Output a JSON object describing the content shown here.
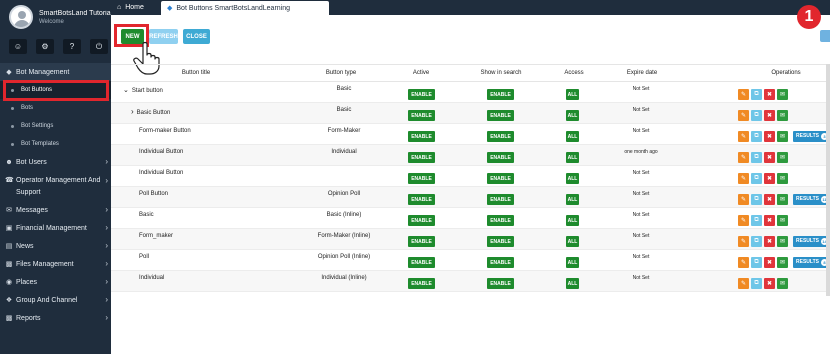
{
  "sidebar": {
    "profile_name": "SmartBotsLand Tutorial",
    "profile_welcome": "Welcome",
    "quick_icons": [
      "user-icon",
      "settings-icon",
      "help-icon",
      "power-icon"
    ],
    "menu": [
      {
        "label": "Bot Management",
        "icon": "diamond-icon",
        "open": true
      },
      {
        "label": "Bot Users",
        "icon": "users-icon"
      },
      {
        "label": "Operator Management And Support",
        "icon": "headset-icon"
      },
      {
        "label": "Messages",
        "icon": "envelope-icon"
      },
      {
        "label": "Financial Management",
        "icon": "money-icon"
      },
      {
        "label": "News",
        "icon": "newspaper-icon"
      },
      {
        "label": "Files Management",
        "icon": "folder-icon"
      },
      {
        "label": "Places",
        "icon": "pin-icon"
      },
      {
        "label": "Group And Channel",
        "icon": "group-icon"
      },
      {
        "label": "Reports",
        "icon": "chart-icon"
      }
    ],
    "submenu": [
      "Bot Buttons",
      "Bots",
      "Bot Settings",
      "Bot Templates"
    ],
    "active_submenu": "Bot Buttons"
  },
  "topbar": {
    "home_tab": "Home",
    "current_tab": "Bot Buttons SmartBotsLandLearning"
  },
  "toolbar": {
    "new_label": "NEW",
    "refresh_label": "REFRESH",
    "close_label": "CLOSE"
  },
  "step_badge": "1",
  "table": {
    "headers": {
      "title": "Button title",
      "type": "Button type",
      "active": "Active",
      "search": "Show in search",
      "access": "Access",
      "expire": "Expire date",
      "operations": "Operations"
    },
    "rows": [
      {
        "title": "Start button",
        "type": "Basic",
        "active": "ENABLE",
        "search": "ENABLE",
        "access": "ALL",
        "expire": "Not Set",
        "expander": "down"
      },
      {
        "title": "Basic Button",
        "type": "Basic",
        "active": "ENABLE",
        "search": "ENABLE",
        "access": "ALL",
        "expire": "Not Set",
        "expander": "right"
      },
      {
        "title": "Form-maker Button",
        "type": "Form-Maker",
        "active": "ENABLE",
        "search": "ENABLE",
        "access": "ALL",
        "expire": "Not Set",
        "results": "RESULTS",
        "results_count": "3"
      },
      {
        "title": "Individual Button",
        "type": "Individual",
        "active": "ENABLE",
        "search": "ENABLE",
        "access": "ALL",
        "expire": "one month ago"
      },
      {
        "title": "Individual Button",
        "type": "",
        "active": "ENABLE",
        "search": "ENABLE",
        "access": "ALL",
        "expire": "Not Set"
      },
      {
        "title": "Poll Button",
        "type": "Opinion Poll",
        "active": "ENABLE",
        "search": "ENABLE",
        "access": "ALL",
        "expire": "Not Set",
        "results": "RESULTS",
        "results_count": "11"
      },
      {
        "title": "Basic",
        "type": "Basic (Inline)",
        "active": "ENABLE",
        "search": "ENABLE",
        "access": "ALL",
        "expire": "Not Set"
      },
      {
        "title": "Form_maker",
        "type": "Form-Maker (Inline)",
        "active": "ENABLE",
        "search": "ENABLE",
        "access": "ALL",
        "expire": "Not Set",
        "results": "RESULTS",
        "results_count": "14"
      },
      {
        "title": "Poll",
        "type": "Opinion Poll (Inline)",
        "active": "ENABLE",
        "search": "ENABLE",
        "access": "ALL",
        "expire": "Not Set",
        "results": "RESULTS",
        "results_count": "8"
      },
      {
        "title": "Individual",
        "type": "Individual (Inline)",
        "active": "ENABLE",
        "search": "ENABLE",
        "access": "ALL",
        "expire": "Not Set"
      }
    ]
  },
  "colors": {
    "sidebar_bg": "#1f2d3d",
    "enable_green": "#1e8b2d",
    "highlight_red": "#e1262d",
    "results_blue": "#2a8fc8"
  }
}
